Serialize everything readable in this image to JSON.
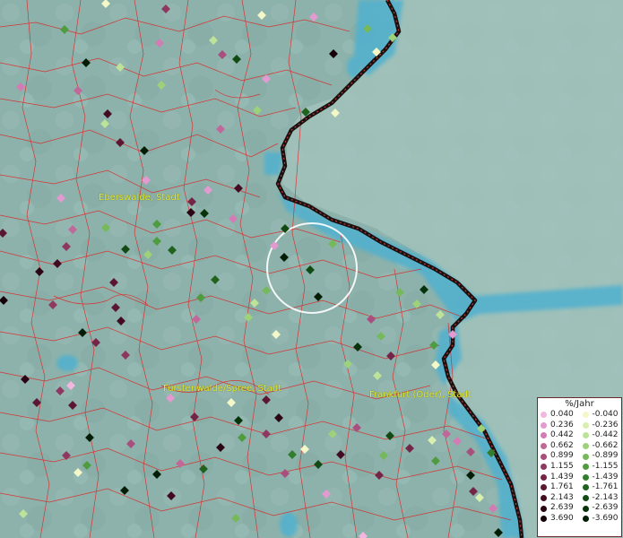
{
  "map": {
    "colors": {
      "background": "#8fb3ad",
      "water": "#4fb0cf",
      "border_line": "#e02020",
      "river_border": "#1a1010",
      "highlight_circle": "#ffffff",
      "label": "#e6e830"
    },
    "places": [
      {
        "name": "Eberswalde, Stadt"
      },
      {
        "name": "Fürstenwalde/Spree, Stadt"
      },
      {
        "name": "Frankfurt (Oder), Stadt"
      }
    ]
  },
  "legend": {
    "title": "%/Jahr",
    "rows": [
      {
        "pos": {
          "label": "0.040",
          "color": "#f2b6e0"
        },
        "neg": {
          "label": "-0.040",
          "color": "#f4f7c8"
        }
      },
      {
        "pos": {
          "label": "0.236",
          "color": "#e39ad1"
        },
        "neg": {
          "label": "-0.236",
          "color": "#d9efb0"
        }
      },
      {
        "pos": {
          "label": "0.442",
          "color": "#d27bb5"
        },
        "neg": {
          "label": "-0.442",
          "color": "#bde398"
        }
      },
      {
        "pos": {
          "label": "0.662",
          "color": "#c1689b"
        },
        "neg": {
          "label": "-0.662",
          "color": "#9dd17a"
        }
      },
      {
        "pos": {
          "label": "0.899",
          "color": "#a84f7d"
        },
        "neg": {
          "label": "-0.899",
          "color": "#76b95a"
        }
      },
      {
        "pos": {
          "label": "1.155",
          "color": "#8e3760"
        },
        "neg": {
          "label": "-1.155",
          "color": "#4f9b3f"
        }
      },
      {
        "pos": {
          "label": "1.439",
          "color": "#742547"
        },
        "neg": {
          "label": "-1.439",
          "color": "#337e2c"
        }
      },
      {
        "pos": {
          "label": "1.761",
          "color": "#5a1632"
        },
        "neg": {
          "label": "-1.761",
          "color": "#1f631e"
        }
      },
      {
        "pos": {
          "label": "2.143",
          "color": "#420b22"
        },
        "neg": {
          "label": "-2.143",
          "color": "#114a13"
        }
      },
      {
        "pos": {
          "label": "2.639",
          "color": "#2b0514"
        },
        "neg": {
          "label": "-2.639",
          "color": "#07330b"
        }
      },
      {
        "pos": {
          "label": "3.690",
          "color": "#160108"
        },
        "neg": {
          "label": "-3.690",
          "color": "#021d05"
        }
      }
    ]
  }
}
